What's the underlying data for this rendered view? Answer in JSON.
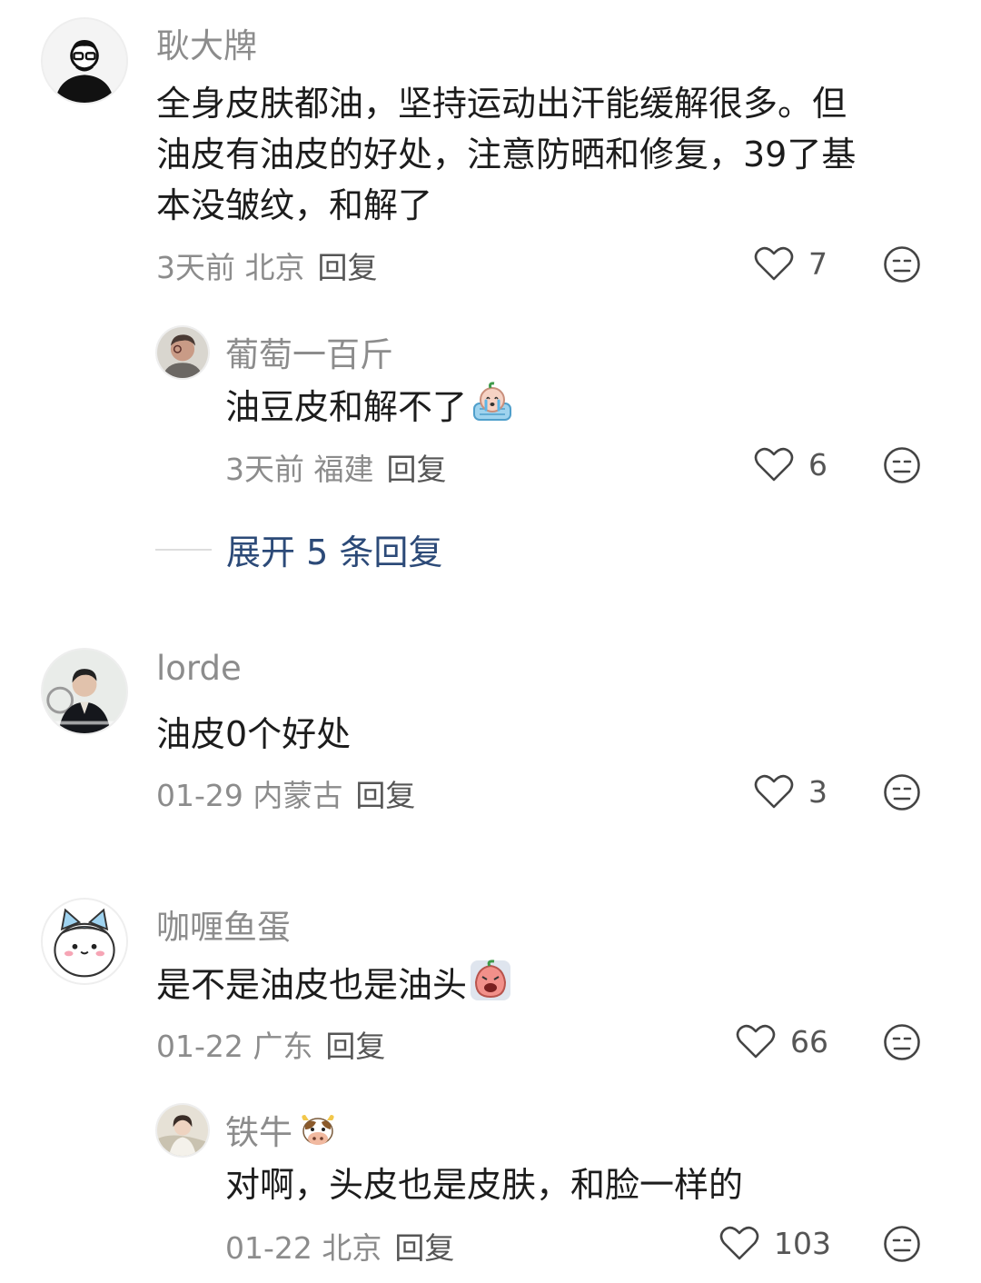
{
  "comments": [
    {
      "name": "耿大牌",
      "text_line1": "全身皮肤都油，坚持运动出汗能缓解很多。但",
      "text_line2": "油皮有油皮的好处，注意防晒和修复，39了基",
      "text_line3": "本没皱纹，和解了",
      "time_location": "3天前 北京",
      "reply_label": "回复",
      "likes": "7",
      "avatar_icon": "man-glasses-avatar"
    },
    {
      "name": "葡萄一百斤",
      "text": "油豆皮和解不了",
      "emoji": "crying-peach-emoji",
      "time_location": "3天前 福建",
      "reply_label": "回复",
      "likes": "6",
      "avatar_icon": "person-photo-avatar"
    },
    {
      "name": "lorde",
      "text": "油皮0个好处",
      "time_location": "01-29 内蒙古",
      "reply_label": "回复",
      "likes": "3",
      "avatar_icon": "man-suit-avatar"
    },
    {
      "name": "咖喱鱼蛋",
      "text": "是不是油皮也是油头",
      "emoji": "scared-peach-emoji",
      "time_location": "01-22 广东",
      "reply_label": "回复",
      "likes": "66",
      "avatar_icon": "cartoon-cat-avatar"
    },
    {
      "name": "铁牛",
      "name_emoji": "cow-emoji",
      "text": "对啊，头皮也是皮肤，和脸一样的",
      "time_location": "01-22 北京",
      "reply_label": "回复",
      "likes": "103",
      "avatar_icon": "girl-photo-avatar"
    }
  ],
  "expand_replies": "展开 5 条回复",
  "colors": {
    "name": "#8c8c8c",
    "text": "#1c1c1c",
    "meta": "#8c8c8c",
    "link": "#2c4a78"
  }
}
